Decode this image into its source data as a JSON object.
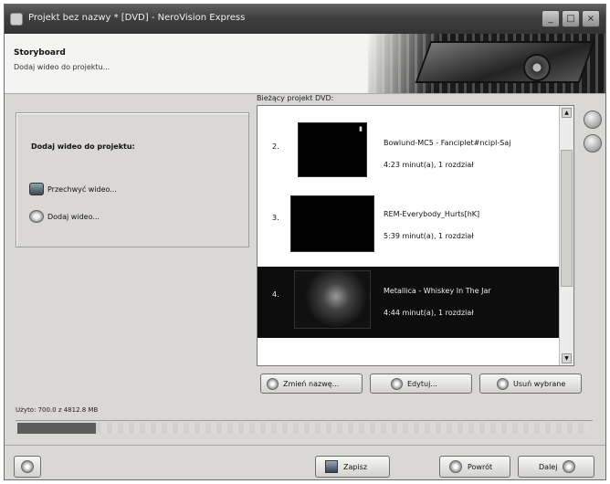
{
  "window": {
    "title": "Projekt bez nazwy * [DVD] - NeroVision Express",
    "controls": [
      "_",
      "□",
      "×"
    ]
  },
  "header": {
    "title": "Storyboard",
    "subtitle": "Dodaj wideo do projektu..."
  },
  "left_panel": {
    "title": "Dodaj wideo do projektu:",
    "actions": [
      {
        "label": "Przechwyć wideo...",
        "icon": "capture-video-icon"
      },
      {
        "label": "Dodaj wideo...",
        "icon": "add-video-icon"
      }
    ]
  },
  "project_list": {
    "label": "Bieżący projekt DVD:",
    "items": [
      {
        "num": "2.",
        "name": "Bowlund-MC5 - Fanciplet#ncipl-Saj",
        "info": "4:23 minut(a), 1 rozdział",
        "selected": false
      },
      {
        "num": "3.",
        "name": "REM-Everybody_Hurts[hK]",
        "info": "5:39 minut(a), 1 rozdział",
        "selected": false
      },
      {
        "num": "4.",
        "name": "Metallica - Whiskey In The Jar",
        "info": "4:44 minut(a), 1 rozdział",
        "selected": true
      }
    ],
    "buttons": [
      {
        "label": "Zmień nazwę...",
        "icon": "rename-icon"
      },
      {
        "label": "Edytuj...",
        "icon": "edit-icon"
      },
      {
        "label": "Usuń wybrane",
        "icon": "delete-icon"
      }
    ]
  },
  "side_buttons": [
    "move-up-icon",
    "move-down-icon"
  ],
  "usage": {
    "label": "Użyto: 700.0 z 4812.8 MB",
    "fraction": 0.145
  },
  "footer": {
    "save_label": "Zapisz",
    "back_label": "Powrót",
    "next_label": "Dalej"
  }
}
